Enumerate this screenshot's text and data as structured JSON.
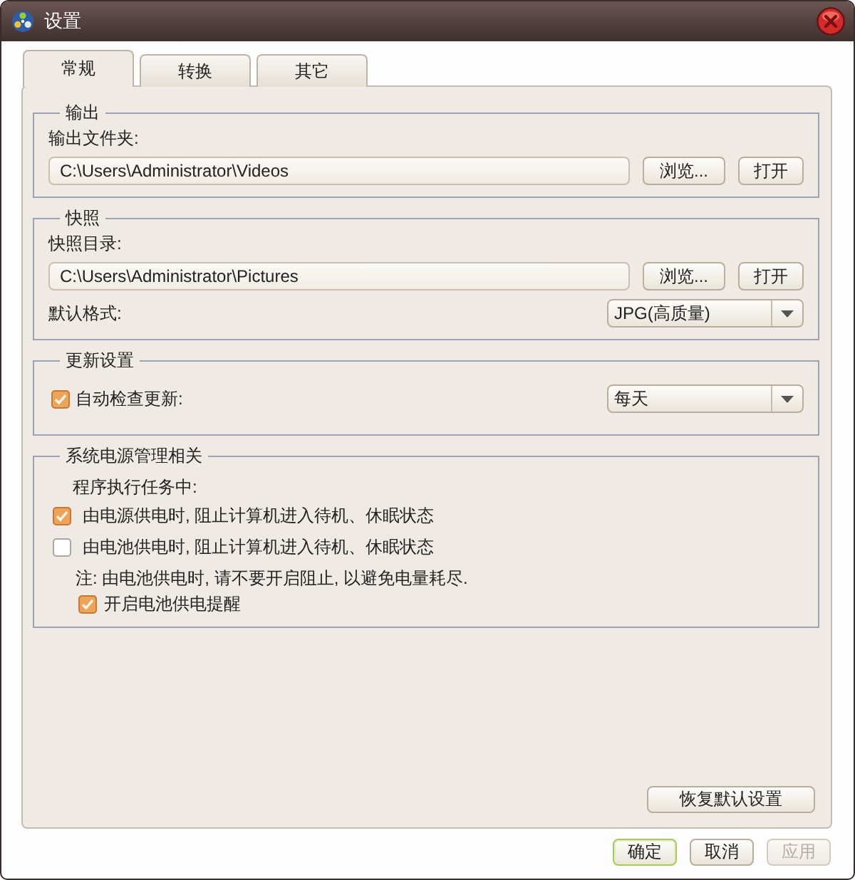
{
  "window": {
    "title": "设置"
  },
  "tabs": [
    {
      "label": "常规",
      "selected": true
    },
    {
      "label": "转换",
      "selected": false
    },
    {
      "label": "其它",
      "selected": false
    }
  ],
  "groups": [
    {
      "title": "输出",
      "rows": [
        {
          "kind": "label",
          "text": "输出文件夹:"
        },
        {
          "kind": "path",
          "value": "C:\\Users\\Administrator\\Videos",
          "buttons": [
            "浏览...",
            "打开"
          ]
        }
      ]
    },
    {
      "title": "快照",
      "rows": [
        {
          "kind": "label",
          "text": "快照目录:"
        },
        {
          "kind": "path",
          "value": "C:\\Users\\Administrator\\Pictures",
          "buttons": [
            "浏览...",
            "打开"
          ]
        },
        {
          "kind": "select",
          "label": "默认格式:",
          "value": "JPG(高质量)"
        }
      ]
    },
    {
      "title": "更新设置",
      "rows": [
        {
          "kind": "check_select",
          "label": "自动检查更新:",
          "checked": true,
          "value": "每天"
        }
      ]
    },
    {
      "title": "系统电源管理相关",
      "rows": [
        {
          "kind": "caption",
          "text": "程序执行任务中:"
        },
        {
          "kind": "checkbox",
          "label": "由电源供电时, 阻止计算机进入待机、休眠状态",
          "checked": true
        },
        {
          "kind": "checkbox",
          "label": "由电池供电时, 阻止计算机进入待机、休眠状态",
          "checked": false
        },
        {
          "kind": "note",
          "text": "注: 由电池供电时, 请不要开启阻止, 以避免电量耗尽."
        },
        {
          "kind": "subcheck",
          "label": "开启电池供电提醒",
          "checked": true
        }
      ]
    }
  ],
  "reset_button": "恢复默认设置",
  "footer_buttons": [
    {
      "label": "确定",
      "default": true,
      "disabled": false
    },
    {
      "label": "取消",
      "default": false,
      "disabled": false
    },
    {
      "label": "应用",
      "default": false,
      "disabled": true
    }
  ]
}
